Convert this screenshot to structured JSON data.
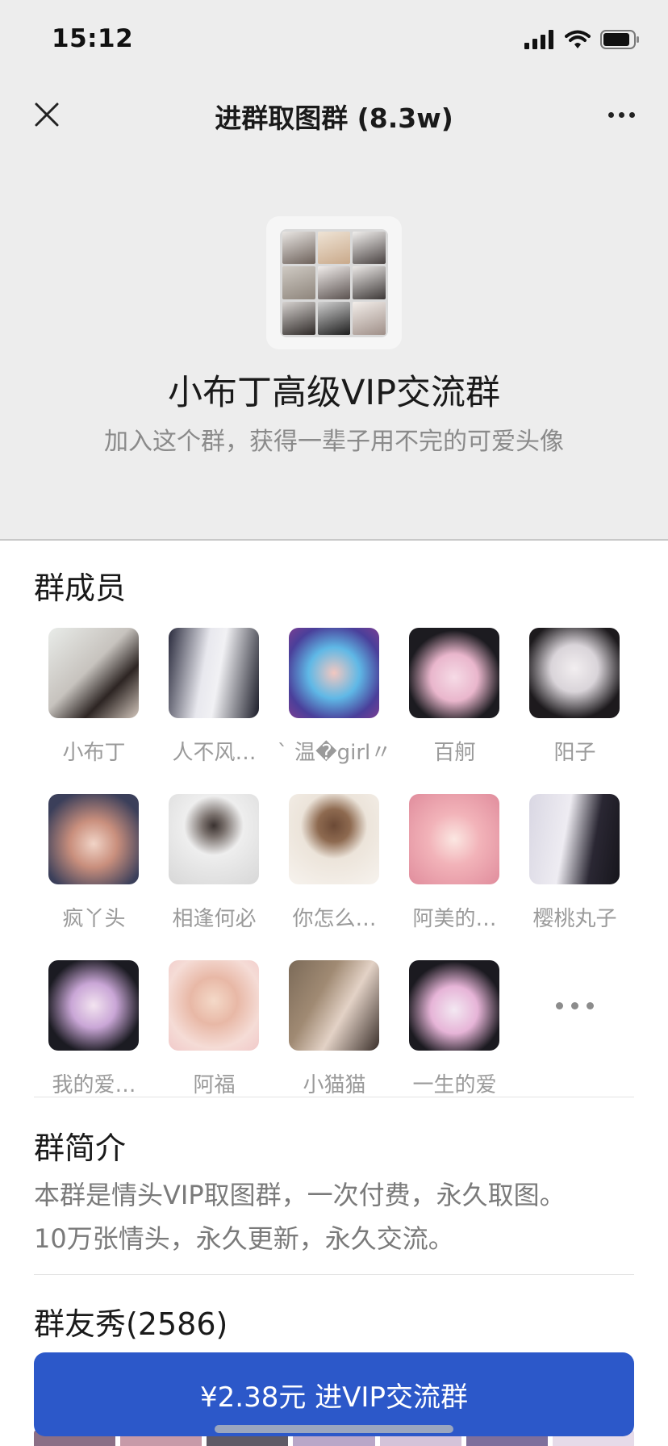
{
  "status_bar": {
    "time": "15:12"
  },
  "nav": {
    "title": "进群取图群 (8.3w)"
  },
  "group": {
    "name": "小布丁高级VIP交流群",
    "tagline": "加入这个群，获得一辈子用不完的可爱头像"
  },
  "members": {
    "title": "群成员",
    "items": [
      {
        "name": "小布丁"
      },
      {
        "name": "人不风…"
      },
      {
        "name": "` 温�girl〃"
      },
      {
        "name": "百舸"
      },
      {
        "name": "阳子"
      },
      {
        "name": "疯丫头"
      },
      {
        "name": "相逢何必"
      },
      {
        "name": "你怎么…"
      },
      {
        "name": "阿美的…"
      },
      {
        "name": "樱桃丸子"
      },
      {
        "name": "我的爱…"
      },
      {
        "name": "阿福"
      },
      {
        "name": "小猫猫"
      },
      {
        "name": "一生的爱"
      }
    ]
  },
  "intro": {
    "title": "群简介",
    "text_line1": "本群是情头VIP取图群，一次付费，永久取图。",
    "text_line2": "10万张情头，永久更新，永久交流。"
  },
  "showcase": {
    "title": "群友秀(2586)"
  },
  "join_button": {
    "label": "¥2.38元 进VIP交流群"
  },
  "colors": {
    "accent": "#2c58c9",
    "header_bg": "#ededed"
  }
}
